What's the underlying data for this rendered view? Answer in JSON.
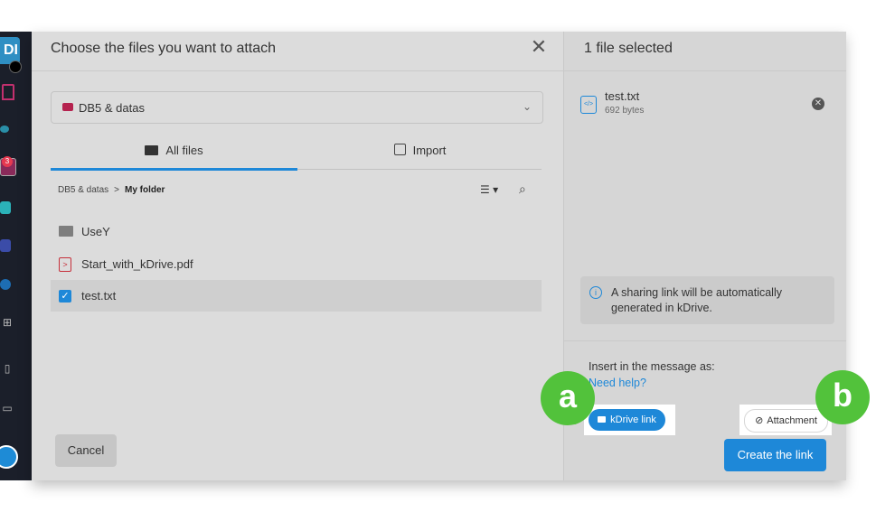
{
  "rail": {
    "avatar_text": "DI",
    "badge_count": "3"
  },
  "dialog": {
    "title": "Choose the files you want to attach",
    "close_glyph": "✕",
    "drive": {
      "name": "DB5 & datas",
      "chevron": "⌄"
    },
    "tabs": [
      {
        "label": "All files"
      },
      {
        "label": "Import"
      }
    ],
    "breadcrumb": {
      "root": "DB5 & datas",
      "sep": ">",
      "current": "My folder"
    },
    "view_glyph": "☰ ▾",
    "search_glyph": "⌕",
    "files": [
      {
        "name": "UseY",
        "type": "folder"
      },
      {
        "name": "Start_with_kDrive.pdf",
        "type": "pdf"
      },
      {
        "name": "test.txt",
        "type": "txt",
        "selected": true
      }
    ],
    "cancel_label": "Cancel"
  },
  "selection": {
    "title": "1 file selected",
    "file_name": "test.txt",
    "file_size": "692 bytes",
    "file_icon_text": "</>",
    "remove_glyph": "✕",
    "info_icon": "i",
    "info_text": "A sharing link will be automatically generated in kDrive.",
    "insert_label": "Insert in the message as:",
    "help_link": "Need help?",
    "option_link": "kDrive link",
    "option_attachment": "Attachment",
    "attachment_icon": "⊘",
    "create_label": "Create the link"
  },
  "markers": {
    "a": "a",
    "b": "b"
  },
  "colors": {
    "accent": "#1e88d8",
    "marker": "#52c23b",
    "drive": "#b5234f"
  }
}
